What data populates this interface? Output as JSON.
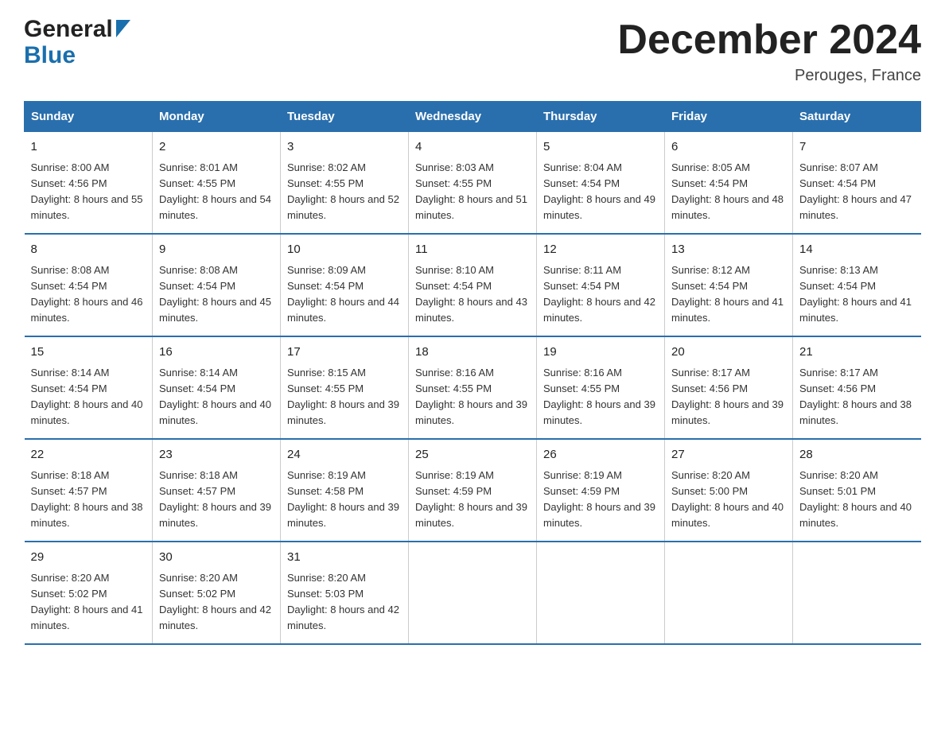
{
  "logo": {
    "general": "General",
    "blue": "Blue"
  },
  "title": "December 2024",
  "location": "Perouges, France",
  "days_of_week": [
    "Sunday",
    "Monday",
    "Tuesday",
    "Wednesday",
    "Thursday",
    "Friday",
    "Saturday"
  ],
  "weeks": [
    [
      {
        "day": "1",
        "sunrise": "8:00 AM",
        "sunset": "4:56 PM",
        "daylight": "8 hours and 55 minutes."
      },
      {
        "day": "2",
        "sunrise": "8:01 AM",
        "sunset": "4:55 PM",
        "daylight": "8 hours and 54 minutes."
      },
      {
        "day": "3",
        "sunrise": "8:02 AM",
        "sunset": "4:55 PM",
        "daylight": "8 hours and 52 minutes."
      },
      {
        "day": "4",
        "sunrise": "8:03 AM",
        "sunset": "4:55 PM",
        "daylight": "8 hours and 51 minutes."
      },
      {
        "day": "5",
        "sunrise": "8:04 AM",
        "sunset": "4:54 PM",
        "daylight": "8 hours and 49 minutes."
      },
      {
        "day": "6",
        "sunrise": "8:05 AM",
        "sunset": "4:54 PM",
        "daylight": "8 hours and 48 minutes."
      },
      {
        "day": "7",
        "sunrise": "8:07 AM",
        "sunset": "4:54 PM",
        "daylight": "8 hours and 47 minutes."
      }
    ],
    [
      {
        "day": "8",
        "sunrise": "8:08 AM",
        "sunset": "4:54 PM",
        "daylight": "8 hours and 46 minutes."
      },
      {
        "day": "9",
        "sunrise": "8:08 AM",
        "sunset": "4:54 PM",
        "daylight": "8 hours and 45 minutes."
      },
      {
        "day": "10",
        "sunrise": "8:09 AM",
        "sunset": "4:54 PM",
        "daylight": "8 hours and 44 minutes."
      },
      {
        "day": "11",
        "sunrise": "8:10 AM",
        "sunset": "4:54 PM",
        "daylight": "8 hours and 43 minutes."
      },
      {
        "day": "12",
        "sunrise": "8:11 AM",
        "sunset": "4:54 PM",
        "daylight": "8 hours and 42 minutes."
      },
      {
        "day": "13",
        "sunrise": "8:12 AM",
        "sunset": "4:54 PM",
        "daylight": "8 hours and 41 minutes."
      },
      {
        "day": "14",
        "sunrise": "8:13 AM",
        "sunset": "4:54 PM",
        "daylight": "8 hours and 41 minutes."
      }
    ],
    [
      {
        "day": "15",
        "sunrise": "8:14 AM",
        "sunset": "4:54 PM",
        "daylight": "8 hours and 40 minutes."
      },
      {
        "day": "16",
        "sunrise": "8:14 AM",
        "sunset": "4:54 PM",
        "daylight": "8 hours and 40 minutes."
      },
      {
        "day": "17",
        "sunrise": "8:15 AM",
        "sunset": "4:55 PM",
        "daylight": "8 hours and 39 minutes."
      },
      {
        "day": "18",
        "sunrise": "8:16 AM",
        "sunset": "4:55 PM",
        "daylight": "8 hours and 39 minutes."
      },
      {
        "day": "19",
        "sunrise": "8:16 AM",
        "sunset": "4:55 PM",
        "daylight": "8 hours and 39 minutes."
      },
      {
        "day": "20",
        "sunrise": "8:17 AM",
        "sunset": "4:56 PM",
        "daylight": "8 hours and 39 minutes."
      },
      {
        "day": "21",
        "sunrise": "8:17 AM",
        "sunset": "4:56 PM",
        "daylight": "8 hours and 38 minutes."
      }
    ],
    [
      {
        "day": "22",
        "sunrise": "8:18 AM",
        "sunset": "4:57 PM",
        "daylight": "8 hours and 38 minutes."
      },
      {
        "day": "23",
        "sunrise": "8:18 AM",
        "sunset": "4:57 PM",
        "daylight": "8 hours and 39 minutes."
      },
      {
        "day": "24",
        "sunrise": "8:19 AM",
        "sunset": "4:58 PM",
        "daylight": "8 hours and 39 minutes."
      },
      {
        "day": "25",
        "sunrise": "8:19 AM",
        "sunset": "4:59 PM",
        "daylight": "8 hours and 39 minutes."
      },
      {
        "day": "26",
        "sunrise": "8:19 AM",
        "sunset": "4:59 PM",
        "daylight": "8 hours and 39 minutes."
      },
      {
        "day": "27",
        "sunrise": "8:20 AM",
        "sunset": "5:00 PM",
        "daylight": "8 hours and 40 minutes."
      },
      {
        "day": "28",
        "sunrise": "8:20 AM",
        "sunset": "5:01 PM",
        "daylight": "8 hours and 40 minutes."
      }
    ],
    [
      {
        "day": "29",
        "sunrise": "8:20 AM",
        "sunset": "5:02 PM",
        "daylight": "8 hours and 41 minutes."
      },
      {
        "day": "30",
        "sunrise": "8:20 AM",
        "sunset": "5:02 PM",
        "daylight": "8 hours and 42 minutes."
      },
      {
        "day": "31",
        "sunrise": "8:20 AM",
        "sunset": "5:03 PM",
        "daylight": "8 hours and 42 minutes."
      },
      null,
      null,
      null,
      null
    ]
  ]
}
